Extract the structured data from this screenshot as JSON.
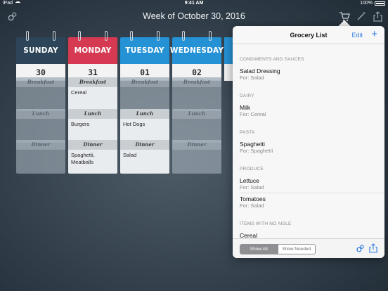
{
  "status": {
    "carrier": "iPad",
    "time": "9:41 AM",
    "battery": "100%"
  },
  "nav": {
    "title": "Week of October 30, 2016",
    "icons": [
      "gears-icon",
      "cart-icon",
      "magic-wand-icon",
      "share-icon"
    ]
  },
  "meal_labels": {
    "breakfast": "Breakfast",
    "lunch": "Lunch",
    "dinner": "Dinner"
  },
  "days": [
    {
      "name": "SUNDAY",
      "date": "30",
      "color": "#2c4558",
      "breakfast": "",
      "lunch": "",
      "dinner": ""
    },
    {
      "name": "MONDAY",
      "date": "31",
      "color": "#d63a52",
      "breakfast": "Cereal",
      "lunch": "Burgers",
      "dinner": "Spaghetti, Meatballs"
    },
    {
      "name": "TUESDAY",
      "date": "01",
      "color": "#2592d6",
      "breakfast": "",
      "lunch": "Hot Dogs",
      "dinner": "Salad"
    },
    {
      "name": "WEDNESDAY",
      "date": "02",
      "color": "#2592d6",
      "breakfast": "",
      "lunch": "",
      "dinner": ""
    }
  ],
  "grocery": {
    "title": "Grocery List",
    "edit_label": "Edit",
    "add_label": "+",
    "sections": [
      {
        "heading": "CONDIMENTS AND SAUCES",
        "items": [
          {
            "name": "Salad Dressing",
            "for": "For: Salad"
          }
        ]
      },
      {
        "heading": "DAIRY",
        "items": [
          {
            "name": "Milk",
            "for": "For: Cereal"
          }
        ]
      },
      {
        "heading": "PASTA",
        "items": [
          {
            "name": "Spaghetti",
            "for": "For: Spaghetti"
          }
        ]
      },
      {
        "heading": "PRODUCE",
        "items": [
          {
            "name": "Lettuce",
            "for": "For: Salad"
          },
          {
            "name": "Tomatoes",
            "for": "For: Salad"
          }
        ]
      },
      {
        "heading": "ITEMS WITH NO AISLE",
        "items": [
          {
            "name": "Cereal",
            "for": ""
          }
        ]
      }
    ],
    "filter": {
      "show_all": "Show All",
      "show_needed": "Show Needed",
      "selected": "Show All"
    }
  }
}
